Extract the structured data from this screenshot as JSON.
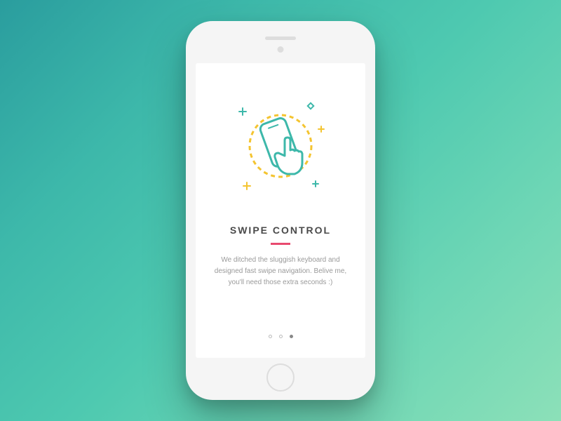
{
  "onboarding": {
    "title": "SWIPE CONTROL",
    "description": "We ditched the sluggish keyboard and designed fast swipe navigation. Belive me, you'll need those extra seconds :)",
    "current_page": 3,
    "total_pages": 3
  },
  "colors": {
    "accent": "#e84a6f",
    "teal": "#3db8aa",
    "yellow": "#f4c430",
    "text_heading": "#4a4a4a",
    "text_body": "#9a9a9a"
  }
}
